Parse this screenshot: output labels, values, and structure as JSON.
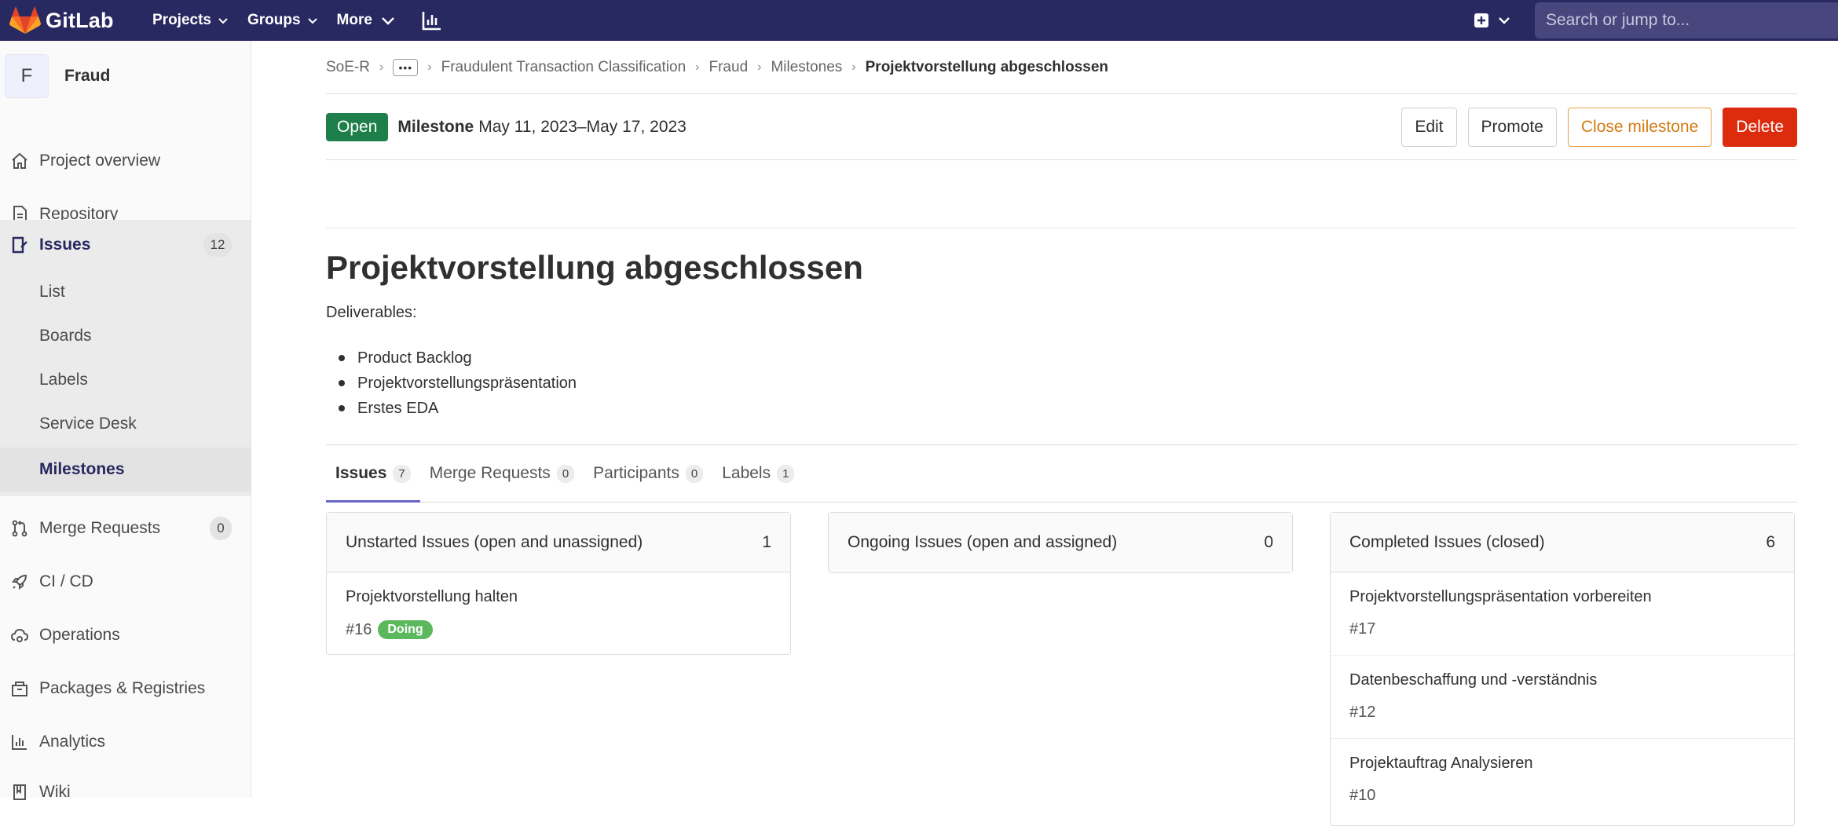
{
  "topbar": {
    "brand": "GitLab",
    "nav": [
      {
        "label": "Projects"
      },
      {
        "label": "Groups"
      },
      {
        "label": "More"
      }
    ],
    "search_placeholder": "Search or jump to..."
  },
  "sidebar": {
    "project_initial": "F",
    "project_name": "Fraud",
    "items": [
      {
        "label": "Project overview",
        "icon": "home-icon"
      },
      {
        "label": "Repository",
        "icon": "document-icon"
      },
      {
        "label": "Issues",
        "icon": "issues-icon",
        "count": "12"
      },
      {
        "label": "Merge Requests",
        "icon": "merge-request-icon",
        "count": "0"
      },
      {
        "label": "CI / CD",
        "icon": "rocket-icon"
      },
      {
        "label": "Operations",
        "icon": "cloud-gear-icon"
      },
      {
        "label": "Packages & Registries",
        "icon": "package-icon"
      },
      {
        "label": "Analytics",
        "icon": "chart-icon"
      },
      {
        "label": "Wiki",
        "icon": "book-icon"
      }
    ],
    "issues_sub": [
      {
        "label": "List"
      },
      {
        "label": "Boards"
      },
      {
        "label": "Labels"
      },
      {
        "label": "Service Desk"
      },
      {
        "label": "Milestones"
      }
    ]
  },
  "breadcrumb": {
    "items": [
      "SoE-R",
      "Fraudulent Transaction Classification",
      "Fraud",
      "Milestones"
    ],
    "current": "Projektvorstellung abgeschlossen"
  },
  "milestone": {
    "status": "Open",
    "label": "Milestone",
    "dates": "May 11, 2023–May 17, 2023",
    "actions": {
      "edit": "Edit",
      "promote": "Promote",
      "close": "Close milestone",
      "delete": "Delete"
    },
    "title": "Projektvorstellung abgeschlossen",
    "description_label": "Deliverables:",
    "deliverables": [
      "Product Backlog",
      "Projektvorstellungspräsentation",
      "Erstes EDA"
    ]
  },
  "tabs": [
    {
      "label": "Issues",
      "count": "7"
    },
    {
      "label": "Merge Requests",
      "count": "0"
    },
    {
      "label": "Participants",
      "count": "0"
    },
    {
      "label": "Labels",
      "count": "1"
    }
  ],
  "columns": {
    "unstarted": {
      "title": "Unstarted Issues (open and unassigned)",
      "count": "1",
      "issues": [
        {
          "title": "Projektvorstellung halten",
          "ref": "#16",
          "label": "Doing"
        }
      ]
    },
    "ongoing": {
      "title": "Ongoing Issues (open and assigned)",
      "count": "0"
    },
    "completed": {
      "title": "Completed Issues (closed)",
      "count": "6",
      "issues": [
        {
          "title": "Projektvorstellungspräsentation vorbereiten",
          "ref": "#17"
        },
        {
          "title": "Datenbeschaffung und -verständnis",
          "ref": "#12"
        },
        {
          "title": "Projektauftrag Analysieren",
          "ref": "#10"
        }
      ]
    }
  },
  "colors": {
    "navbar": "#292961",
    "open_badge": "#1f7f4a",
    "delete": "#dd2b0e",
    "close_milestone": "#d27b12",
    "label_doing": "#5cb85c"
  }
}
